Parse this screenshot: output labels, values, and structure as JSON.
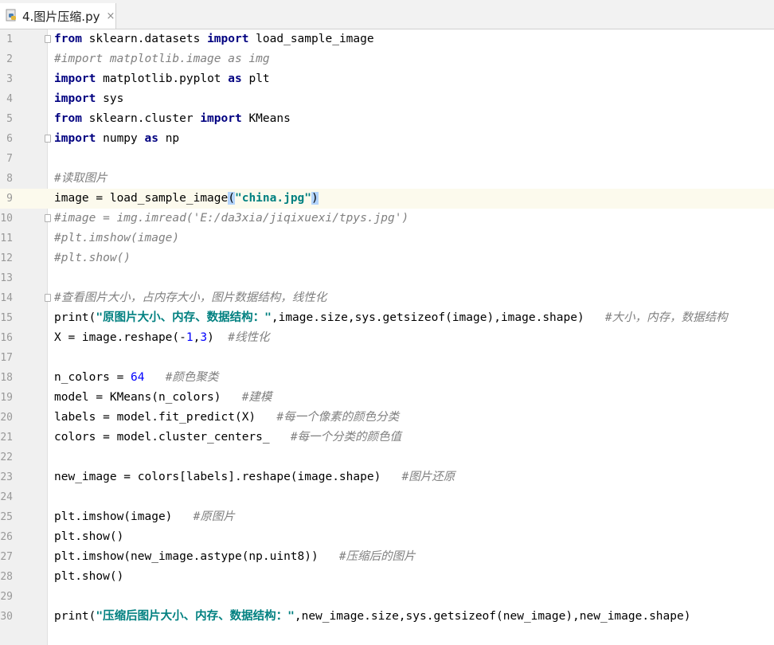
{
  "tab": {
    "title": "4.图片压缩.py",
    "icon": "python-file-icon",
    "close": "×"
  },
  "editor": {
    "current_line": 9,
    "lines": [
      {
        "n": "1",
        "tokens": [
          {
            "t": "kw",
            "v": "from"
          },
          {
            "t": "p",
            "v": " sklearn.datasets "
          },
          {
            "t": "kw",
            "v": "import"
          },
          {
            "t": "p",
            "v": " load_sample_image"
          }
        ]
      },
      {
        "n": "2",
        "tokens": [
          {
            "t": "cm",
            "v": "#import matplotlib.image as img"
          }
        ]
      },
      {
        "n": "3",
        "tokens": [
          {
            "t": "kw",
            "v": "import"
          },
          {
            "t": "p",
            "v": " matplotlib.pyplot "
          },
          {
            "t": "kw",
            "v": "as"
          },
          {
            "t": "p",
            "v": " plt"
          }
        ]
      },
      {
        "n": "4",
        "tokens": [
          {
            "t": "kw",
            "v": "import"
          },
          {
            "t": "p",
            "v": " sys"
          }
        ]
      },
      {
        "n": "5",
        "tokens": [
          {
            "t": "kw",
            "v": "from"
          },
          {
            "t": "p",
            "v": " sklearn.cluster "
          },
          {
            "t": "kw",
            "v": "import"
          },
          {
            "t": "p",
            "v": " KMeans"
          }
        ]
      },
      {
        "n": "6",
        "tokens": [
          {
            "t": "kw",
            "v": "import"
          },
          {
            "t": "p",
            "v": " numpy "
          },
          {
            "t": "kw",
            "v": "as"
          },
          {
            "t": "p",
            "v": " np"
          }
        ]
      },
      {
        "n": "7",
        "tokens": []
      },
      {
        "n": "8",
        "tokens": [
          {
            "t": "cm",
            "v": "#读取图片"
          }
        ]
      },
      {
        "n": "9",
        "tokens": [
          {
            "t": "p",
            "v": "image = load_sample_image"
          },
          {
            "t": "hl",
            "v": "("
          },
          {
            "t": "st",
            "v": "\"china.jpg\""
          },
          {
            "t": "hl",
            "v": ")"
          }
        ]
      },
      {
        "n": "10",
        "tokens": [
          {
            "t": "cm",
            "v": "#image = img.imread('E:/da3xia/jiqixuexi/tpys.jpg')"
          }
        ]
      },
      {
        "n": "11",
        "tokens": [
          {
            "t": "cm",
            "v": "#plt.imshow(image)"
          }
        ]
      },
      {
        "n": "12",
        "tokens": [
          {
            "t": "cm",
            "v": "#plt.show()"
          }
        ]
      },
      {
        "n": "13",
        "tokens": []
      },
      {
        "n": "14",
        "tokens": [
          {
            "t": "cm",
            "v": "#查看图片大小，占内存大小，图片数据结构，线性化"
          }
        ]
      },
      {
        "n": "15",
        "tokens": [
          {
            "t": "p",
            "v": "print("
          },
          {
            "t": "st",
            "v": "\"原图片大小、内存、数据结构：\""
          },
          {
            "t": "p",
            "v": ",image.size,sys.getsizeof(image),image.shape)   "
          },
          {
            "t": "cm",
            "v": "#大小，内存，数据结构"
          }
        ]
      },
      {
        "n": "16",
        "tokens": [
          {
            "t": "p",
            "v": "X = image.reshape(-"
          },
          {
            "t": "nm",
            "v": "1"
          },
          {
            "t": "p",
            "v": ","
          },
          {
            "t": "nm",
            "v": "3"
          },
          {
            "t": "p",
            "v": ")  "
          },
          {
            "t": "cm",
            "v": "#线性化"
          }
        ]
      },
      {
        "n": "17",
        "tokens": []
      },
      {
        "n": "18",
        "tokens": [
          {
            "t": "p",
            "v": "n_colors = "
          },
          {
            "t": "nm",
            "v": "64"
          },
          {
            "t": "p",
            "v": "   "
          },
          {
            "t": "cm",
            "v": "#颜色聚类"
          }
        ]
      },
      {
        "n": "19",
        "tokens": [
          {
            "t": "p",
            "v": "model = KMeans(n_colors)   "
          },
          {
            "t": "cm",
            "v": "#建模"
          }
        ]
      },
      {
        "n": "20",
        "tokens": [
          {
            "t": "p",
            "v": "labels = model.fit_predict(X)   "
          },
          {
            "t": "cm",
            "v": "#每一个像素的颜色分类"
          }
        ]
      },
      {
        "n": "21",
        "tokens": [
          {
            "t": "p",
            "v": "colors = model.cluster_centers_   "
          },
          {
            "t": "cm",
            "v": "#每一个分类的颜色值"
          }
        ]
      },
      {
        "n": "22",
        "tokens": []
      },
      {
        "n": "23",
        "tokens": [
          {
            "t": "p",
            "v": "new_image = colors[labels].reshape(image.shape)   "
          },
          {
            "t": "cm",
            "v": "#图片还原"
          }
        ]
      },
      {
        "n": "24",
        "tokens": []
      },
      {
        "n": "25",
        "tokens": [
          {
            "t": "p",
            "v": "plt.imshow(image)   "
          },
          {
            "t": "cm",
            "v": "#原图片"
          }
        ]
      },
      {
        "n": "26",
        "tokens": [
          {
            "t": "p",
            "v": "plt.show()"
          }
        ]
      },
      {
        "n": "27",
        "tokens": [
          {
            "t": "p",
            "v": "plt.imshow(new_image.astype(np.uint8))   "
          },
          {
            "t": "cm",
            "v": "#压缩后的图片"
          }
        ]
      },
      {
        "n": "28",
        "tokens": [
          {
            "t": "p",
            "v": "plt.show()"
          }
        ]
      },
      {
        "n": "29",
        "tokens": []
      },
      {
        "n": "30",
        "tokens": [
          {
            "t": "p",
            "v": "print("
          },
          {
            "t": "st",
            "v": "\"压缩后图片大小、内存、数据结构：\""
          },
          {
            "t": "p",
            "v": ",new_image.size,sys.getsizeof(new_image),new_image.shape)"
          }
        ]
      }
    ]
  },
  "colors": {
    "keyword": "#000080",
    "comment": "#808080",
    "string": "#008080",
    "number": "#0000ff",
    "current_line": "#fcfaed",
    "bracket_match": "#b3d4fc"
  }
}
